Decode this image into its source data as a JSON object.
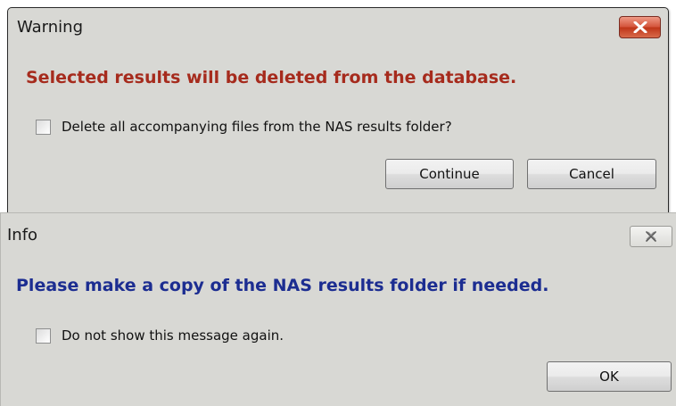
{
  "warning_dialog": {
    "title": "Warning",
    "close_icon": "close-x-icon",
    "message": "Selected results will be deleted from the database.",
    "checkbox_label": "Delete all accompanying files from the NAS results folder?",
    "checkbox_checked": false,
    "continue_label": "Continue",
    "cancel_label": "Cancel",
    "message_color": "#a62b1d",
    "close_button_color": "#c9442a"
  },
  "info_dialog": {
    "title": "Info",
    "close_icon": "close-x-icon",
    "message": "Please make a copy of the NAS results folder if needed.",
    "checkbox_label": "Do not show this message again.",
    "checkbox_checked": false,
    "ok_label": "OK",
    "message_color": "#1c2d91"
  }
}
